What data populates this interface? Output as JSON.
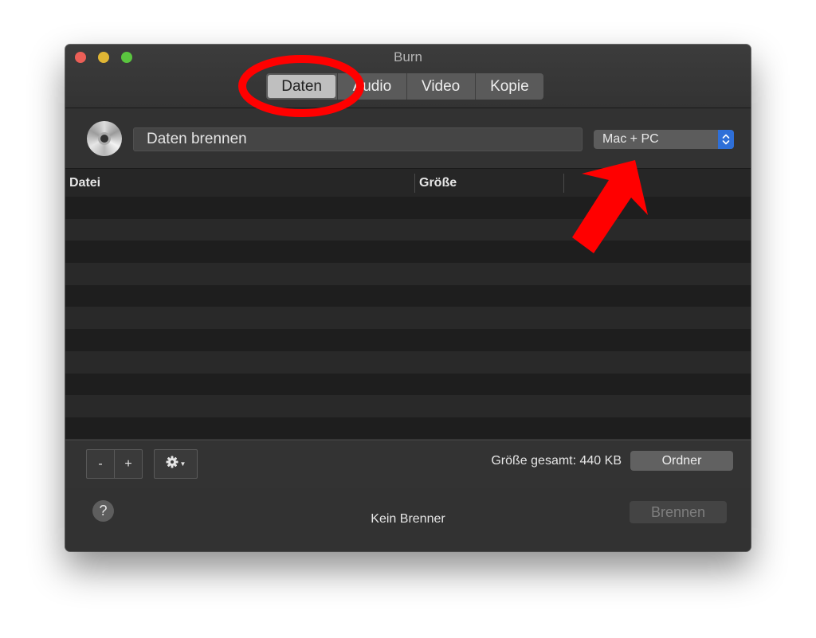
{
  "window": {
    "title": "Burn",
    "tabs": [
      {
        "label": "Daten",
        "active": true
      },
      {
        "label": "Audio",
        "active": false
      },
      {
        "label": "Video",
        "active": false
      },
      {
        "label": "Kopie",
        "active": false
      }
    ]
  },
  "disc_settings": {
    "name_value": "Daten brennen",
    "format_selected": "Mac + PC"
  },
  "table": {
    "columns": [
      "Datei",
      "Größe",
      ""
    ],
    "rows": []
  },
  "bottom_bar": {
    "remove_label": "-",
    "add_label": "+",
    "total_size_text": "Größe gesamt: 440 KB",
    "folder_button_label": "Ordner"
  },
  "footer": {
    "help_label": "?",
    "status_text": "Kein Brenner",
    "burn_button_label": "Brennen",
    "burn_button_enabled": false
  },
  "annotations": {
    "color": "#ff0000"
  }
}
